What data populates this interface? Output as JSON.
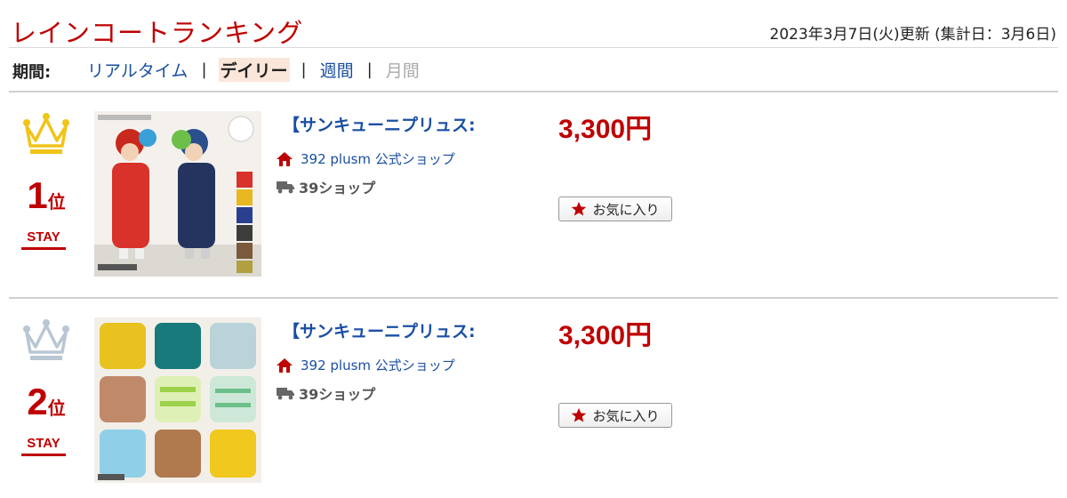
{
  "header": {
    "title": "レインコートランキング",
    "updated": "2023年3月7日(火)更新 (集計日：3月6日)"
  },
  "period": {
    "label": "期間:",
    "tabs": [
      {
        "label": "リアルタイム",
        "state": "link"
      },
      {
        "label": "デイリー",
        "state": "active"
      },
      {
        "label": "週間",
        "state": "link"
      },
      {
        "label": "月間",
        "state": "disabled"
      }
    ],
    "separator": "|"
  },
  "items": [
    {
      "rank": "1",
      "rank_suffix": "位",
      "crown_icon": "gold-crown-icon",
      "crown_color": "#f0c419",
      "status": "STAY",
      "name": "【サンキューニプリュス:",
      "shop": "392 plusm 公式ショップ",
      "shipping": "39ショップ",
      "price": "3,300円",
      "favorite_label": "お気に入り"
    },
    {
      "rank": "2",
      "rank_suffix": "位",
      "crown_icon": "silver-crown-icon",
      "crown_color": "#b9c6d3",
      "status": "STAY",
      "name": "【サンキューニプリュス:",
      "shop": "392 plusm 公式ショップ",
      "shipping": "39ショップ",
      "price": "3,300円",
      "favorite_label": "お気に入り"
    }
  ],
  "colors": {
    "accent_red": "#bf0000",
    "link_blue": "#1a4fa3"
  }
}
